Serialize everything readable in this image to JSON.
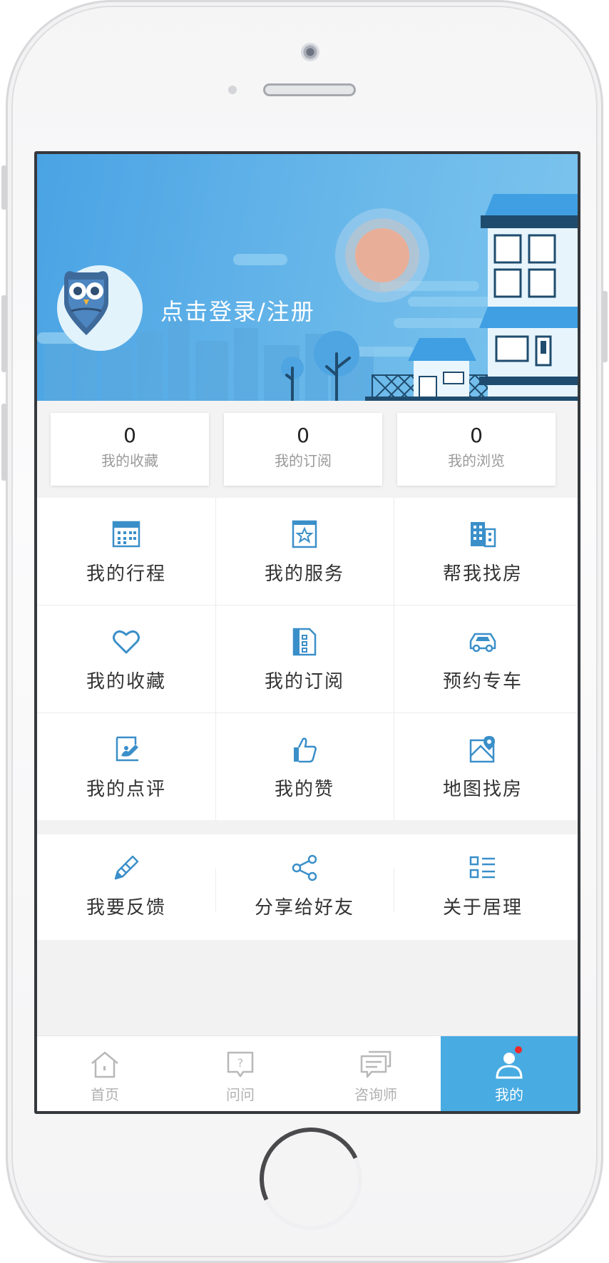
{
  "profile": {
    "login_prompt": "点击登录/注册"
  },
  "stats": [
    {
      "value": "0",
      "label": "我的收藏"
    },
    {
      "value": "0",
      "label": "我的订阅"
    },
    {
      "value": "0",
      "label": "我的浏览"
    }
  ],
  "menu": [
    {
      "label": "我的行程",
      "icon": "calendar-icon"
    },
    {
      "label": "我的服务",
      "icon": "service-star-icon"
    },
    {
      "label": "帮我找房",
      "icon": "building-icon"
    },
    {
      "label": "我的收藏",
      "icon": "heart-icon"
    },
    {
      "label": "我的订阅",
      "icon": "document-icon"
    },
    {
      "label": "预约专车",
      "icon": "car-icon"
    },
    {
      "label": "我的点评",
      "icon": "review-edit-icon"
    },
    {
      "label": "我的赞",
      "icon": "thumbs-up-icon"
    },
    {
      "label": "地图找房",
      "icon": "map-pin-icon"
    }
  ],
  "extra_menu": [
    {
      "label": "我要反馈",
      "icon": "pencil-icon"
    },
    {
      "label": "分享给好友",
      "icon": "share-icon"
    },
    {
      "label": "关于居理",
      "icon": "list-icon"
    }
  ],
  "tabbar": [
    {
      "label": "首页",
      "icon": "home-icon",
      "active": false
    },
    {
      "label": "问问",
      "icon": "question-icon",
      "active": false
    },
    {
      "label": "咨询师",
      "icon": "chat-icon",
      "active": false
    },
    {
      "label": "我的",
      "icon": "user-icon",
      "active": true
    }
  ],
  "colors": {
    "accent": "#48abe2",
    "icon_blue": "#3a8fc9",
    "badge": "#ee2a2a"
  }
}
